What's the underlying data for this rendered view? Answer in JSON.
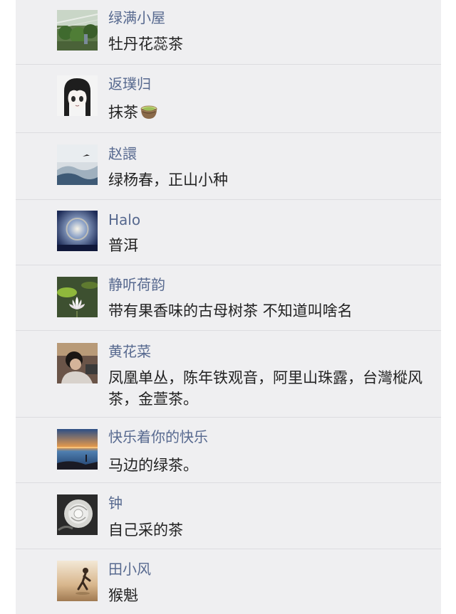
{
  "comments": [
    {
      "name": "绿满小屋",
      "text": "牡丹花蕊茶",
      "avatar": "greenhouse-avatar"
    },
    {
      "name": "返璞归",
      "text": "抹茶",
      "emoji": "tea-cup-icon",
      "avatar": "anime-girl-avatar"
    },
    {
      "name": "赵譞",
      "text": "绿杨春，正山小种",
      "avatar": "misty-mountain-bird-avatar"
    },
    {
      "name": "Halo",
      "text": "普洱",
      "avatar": "sky-halo-avatar"
    },
    {
      "name": "静听荷韵",
      "text": "带有果香味的古母树茶 不知道叫啥名",
      "avatar": "lotus-flower-avatar"
    },
    {
      "name": "黄花菜",
      "text": "凤凰单丛，陈年铁观音，阿里山珠露，台灣樅风茶，金萱茶。",
      "avatar": "person-photo-avatar"
    },
    {
      "name": "快乐着你的快乐",
      "text": "马边的绿茶。",
      "avatar": "sunset-sea-avatar"
    },
    {
      "name": "钟",
      "text": "自己采的茶",
      "avatar": "white-rose-avatar"
    },
    {
      "name": "田小风",
      "text": "猴魁",
      "avatar": "beach-silhouette-avatar"
    }
  ],
  "colors": {
    "background": "#efeff1",
    "name": "#57698f",
    "text": "#222222",
    "divider": "#dcdce0"
  }
}
